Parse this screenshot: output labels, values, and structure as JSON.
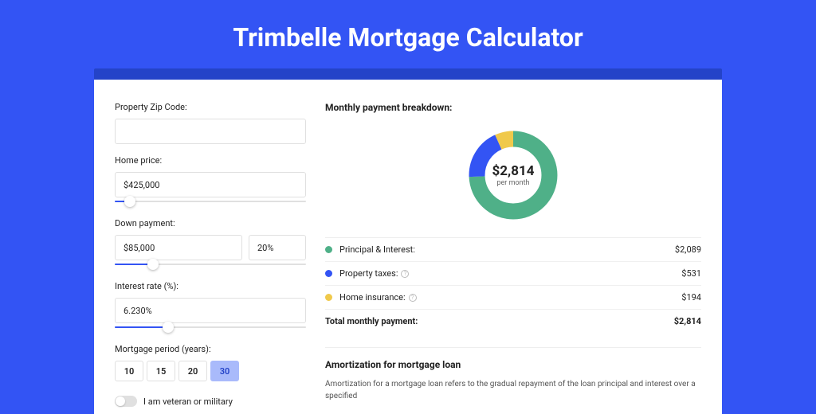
{
  "title": "Trimbelle Mortgage Calculator",
  "form": {
    "zip_label": "Property Zip Code:",
    "zip_value": "",
    "home_price_label": "Home price:",
    "home_price_value": "$425,000",
    "down_payment_label": "Down payment:",
    "down_payment_value": "$85,000",
    "down_payment_pct": "20%",
    "interest_label": "Interest rate (%):",
    "interest_value": "6.230%",
    "period_label": "Mortgage period (years):",
    "periods": [
      "10",
      "15",
      "20",
      "30"
    ],
    "period_active": "30",
    "veteran_label": "I am veteran or military"
  },
  "breakdown": {
    "title": "Monthly payment breakdown:",
    "center_amount": "$2,814",
    "center_sub": "per month",
    "items": [
      {
        "label": "Principal & Interest:",
        "value": "$2,089",
        "color": "#4fb088",
        "info": false
      },
      {
        "label": "Property taxes:",
        "value": "$531",
        "color": "#3354f4",
        "info": true
      },
      {
        "label": "Home insurance:",
        "value": "$194",
        "color": "#f0c94b",
        "info": true
      }
    ],
    "total_label": "Total monthly payment:",
    "total_value": "$2,814"
  },
  "amort": {
    "title": "Amortization for mortgage loan",
    "text": "Amortization for a mortgage loan refers to the gradual repayment of the loan principal and interest over a specified"
  },
  "sliders": {
    "home_price_pct": 8,
    "down_payment_pct": 20,
    "interest_pct": 28
  },
  "chart_data": {
    "type": "pie",
    "title": "Monthly payment breakdown",
    "categories": [
      "Principal & Interest",
      "Property taxes",
      "Home insurance"
    ],
    "values": [
      2089,
      531,
      194
    ],
    "colors": [
      "#4fb088",
      "#3354f4",
      "#f0c94b"
    ],
    "total": 2814
  }
}
